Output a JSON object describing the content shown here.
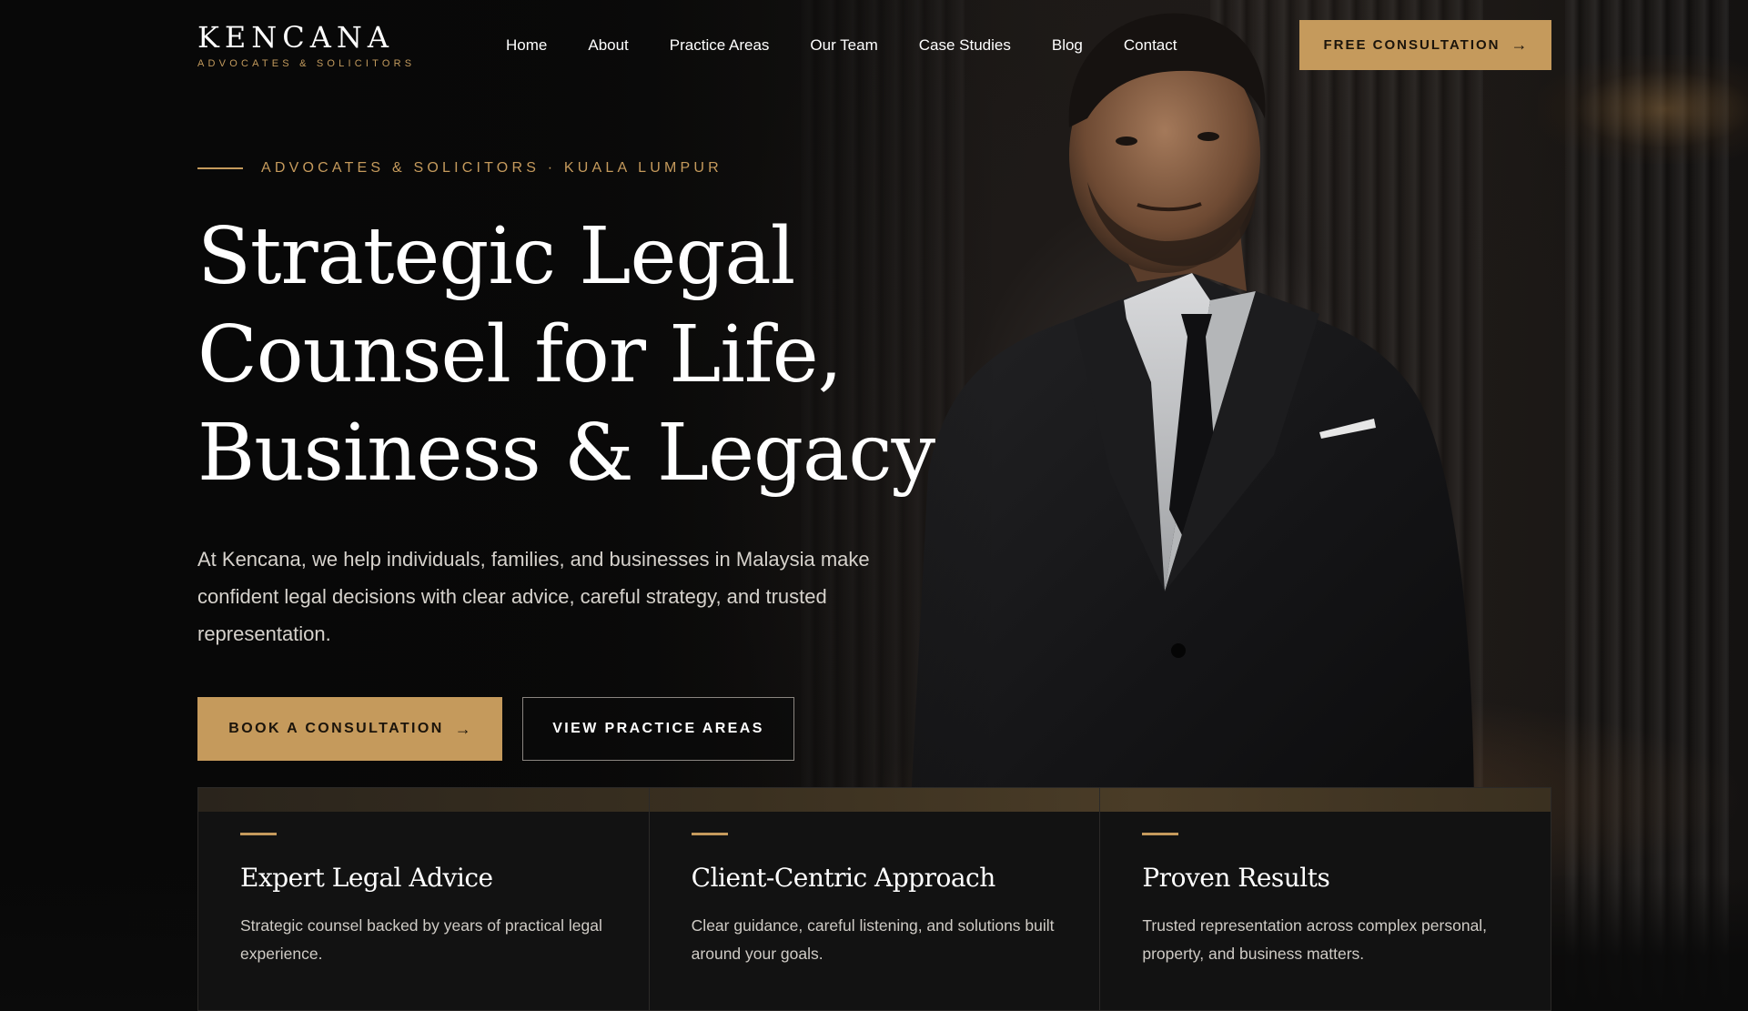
{
  "brand": {
    "name": "KENCANA",
    "tagline": "ADVOCATES & SOLICITORS"
  },
  "nav": {
    "items": [
      "Home",
      "About",
      "Practice Areas",
      "Our Team",
      "Case Studies",
      "Blog",
      "Contact"
    ],
    "cta_label": "FREE CONSULTATION",
    "cta_icon": "arrow-right-icon"
  },
  "hero": {
    "eyebrow": "ADVOCATES & SOLICITORS · KUALA LUMPUR",
    "title_lines": [
      "Strategic Legal",
      "Counsel for Life,",
      "Business & Legacy"
    ],
    "description": "At Kencana, we help individuals, families, and businesses in Malaysia make confident legal decisions with clear advice, careful strategy, and trusted representation.",
    "primary_cta": "BOOK A CONSULTATION",
    "secondary_cta": "VIEW PRACTICE AREAS"
  },
  "features": [
    {
      "title": "Expert Legal Advice",
      "description": "Strategic counsel backed by years of practical legal experience."
    },
    {
      "title": "Client-Centric Approach",
      "description": "Clear guidance, careful listening, and solutions built around your goals."
    },
    {
      "title": "Proven Results",
      "description": "Trusted representation across complex personal, property, and business matters."
    }
  ],
  "theme": {
    "accent": "#c59a5c",
    "background": "#0b0b0b",
    "card_background": "#121212"
  }
}
